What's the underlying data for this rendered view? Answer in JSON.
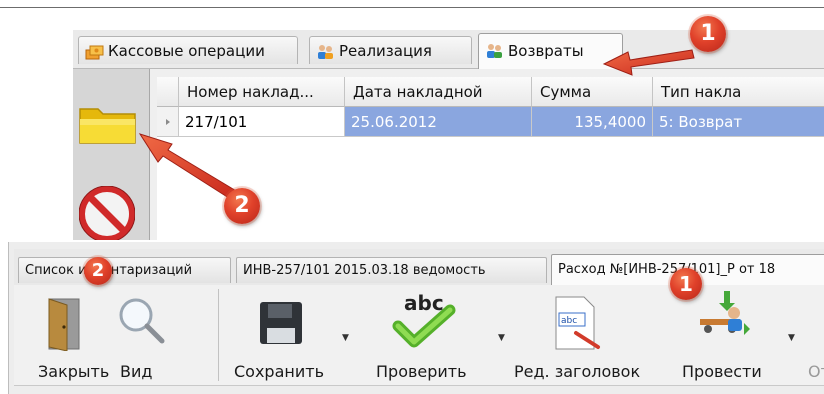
{
  "upper": {
    "tabs": [
      {
        "label": "Кассовые операции",
        "icon": "cash-icon"
      },
      {
        "label": "Реализация",
        "icon": "people-icon"
      },
      {
        "label": "Возвраты",
        "icon": "people-return-icon"
      }
    ],
    "sidebar": [
      {
        "icon": "folder-icon"
      },
      {
        "icon": "no-entry-icon"
      }
    ],
    "grid": {
      "columns": [
        "Номер наклад...",
        "Дата накладной",
        "Сумма",
        "Тип накла"
      ],
      "rows": [
        {
          "number": "217/101",
          "date": "25.06.2012",
          "sum": "135,4000",
          "type": "5:  Возврат"
        }
      ]
    }
  },
  "lower": {
    "tabs": [
      {
        "label": "Список инвентаризаций"
      },
      {
        "label": "ИНВ-257/101 2015.03.18 ведомость"
      },
      {
        "label": "Расход №[ИНВ-257/101]_Р от 18"
      }
    ],
    "toolbar": {
      "close_label": "Закрыть",
      "view_label": "Вид",
      "save_label": "Сохранить",
      "check_label": "Проверить",
      "edit_header_label": "Ред. заголовок",
      "post_label": "Провести",
      "cut_label": "От",
      "check_icon_text": "abc",
      "edit_icon_text": "abc"
    }
  },
  "annotations": {
    "badge_upper_1": "1",
    "badge_upper_2": "2",
    "badge_lower_2": "2",
    "badge_lower_1": "1",
    "color": "#e0412a"
  }
}
